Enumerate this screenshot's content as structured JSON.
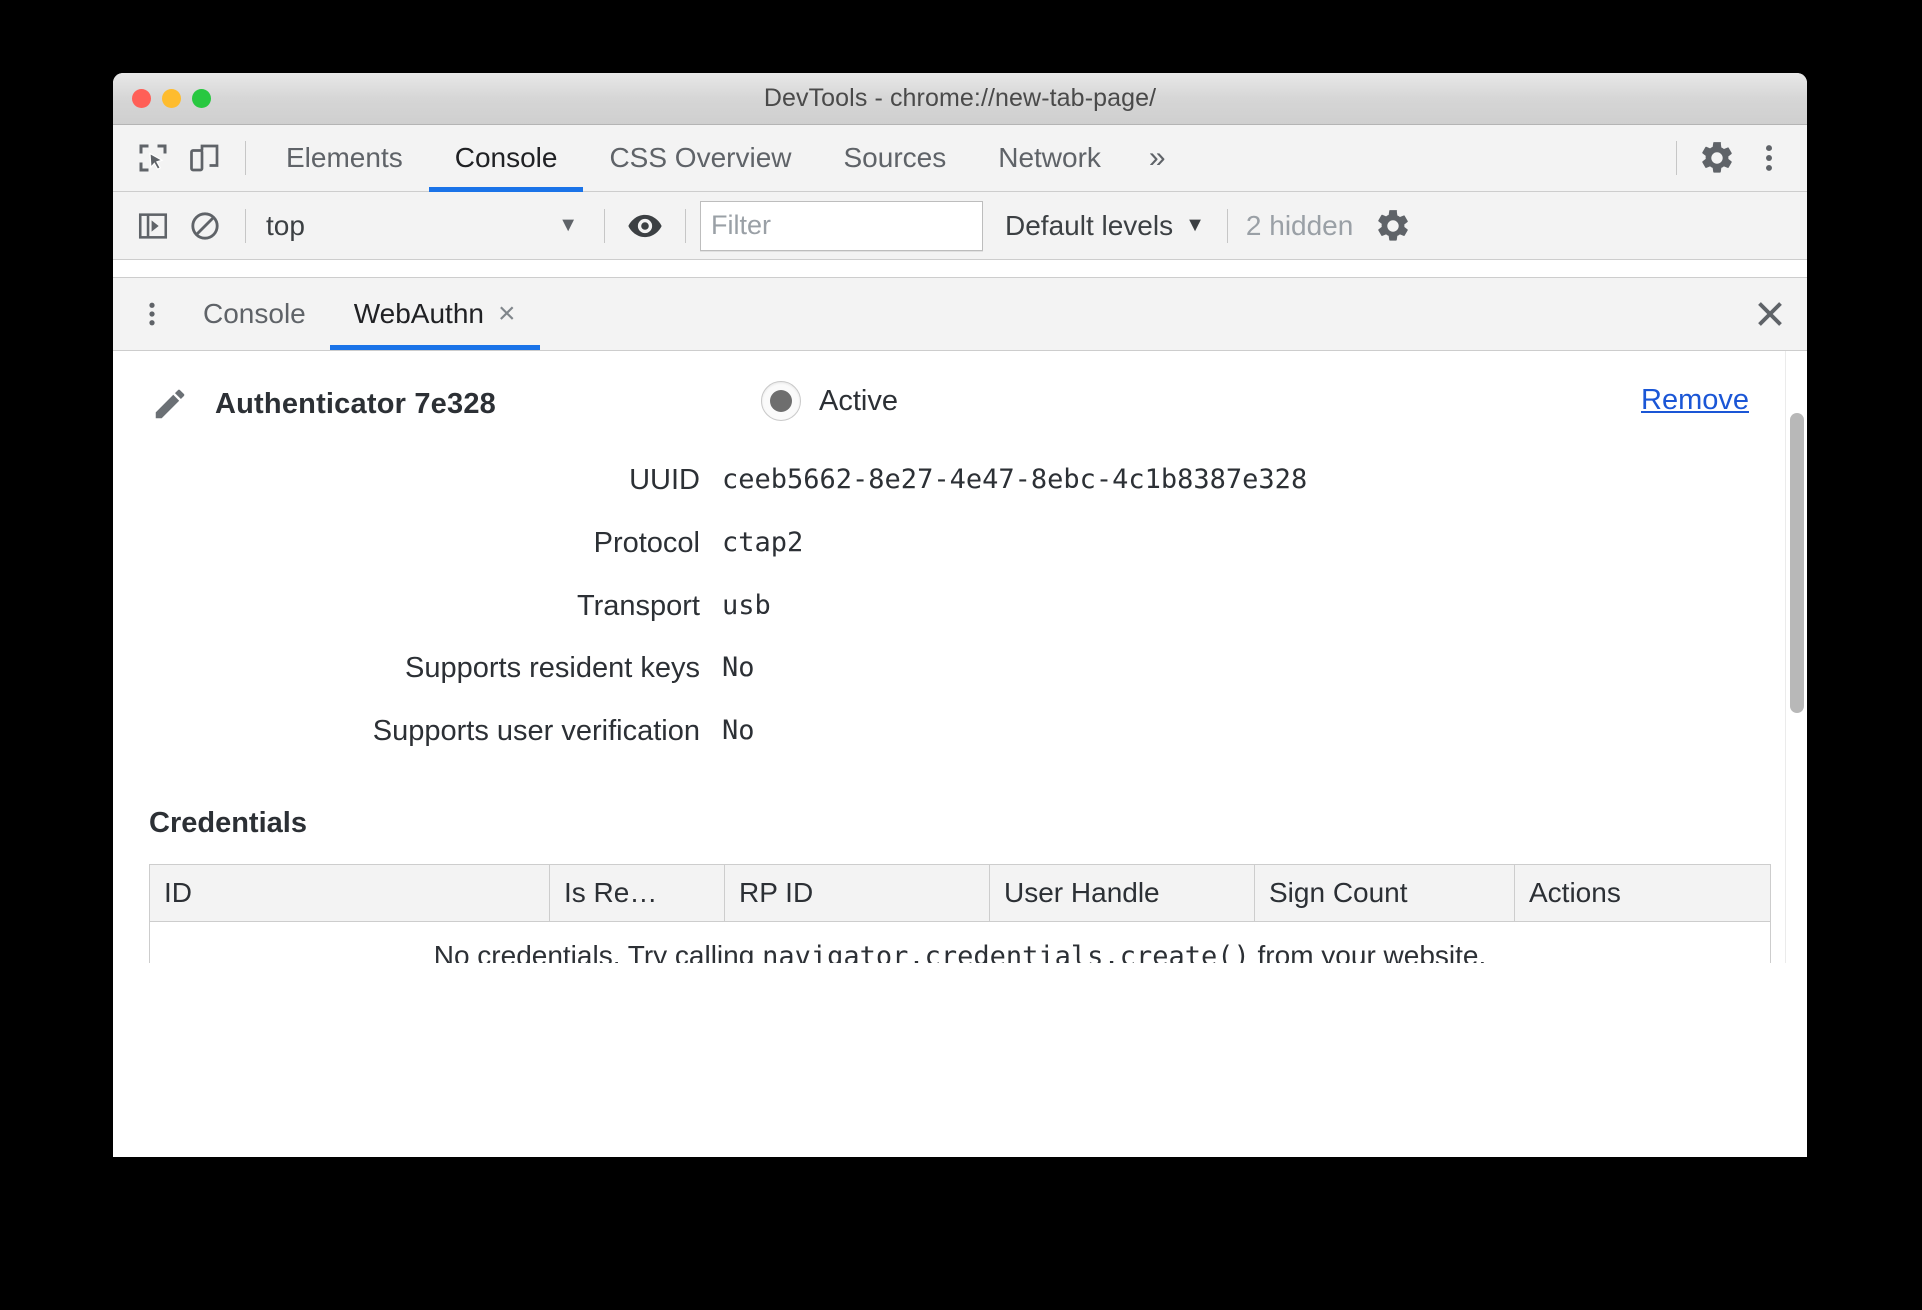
{
  "window": {
    "title": "DevTools - chrome://new-tab-page/",
    "traffic_lights": [
      "close",
      "minimize",
      "zoom"
    ],
    "colors": {
      "accent": "#1a73e8",
      "link": "#1a56d6",
      "close_dot": "#ff5f57",
      "minimize_dot": "#febc2e",
      "zoom_dot": "#28c840"
    }
  },
  "main_toolbar": {
    "inspect_icon": "inspect-element-icon",
    "device_toggle_icon": "device-toolbar-icon",
    "tabs": [
      {
        "label": "Elements",
        "active": false
      },
      {
        "label": "Console",
        "active": true
      },
      {
        "label": "CSS Overview",
        "active": false
      },
      {
        "label": "Sources",
        "active": false
      },
      {
        "label": "Network",
        "active": false
      }
    ],
    "more_tabs_label": "»",
    "settings_icon": "gear-icon",
    "main_menu_icon": "kebab-menu-icon"
  },
  "console_toolbar": {
    "sidebar_toggle_icon": "console-sidebar-icon",
    "clear_console_icon": "clear-console-icon",
    "context": {
      "value": "top",
      "caret": "▼"
    },
    "eye_icon": "live-expression-icon",
    "filter": {
      "value": "",
      "placeholder": "Filter"
    },
    "levels": {
      "label": "Default levels",
      "caret": "▼"
    },
    "hidden_messages": "2 hidden",
    "console_settings_icon": "gear-icon"
  },
  "drawer": {
    "menu_icon": "kebab-menu-icon",
    "tabs": [
      {
        "label": "Console",
        "active": false,
        "closable": false
      },
      {
        "label": "WebAuthn",
        "active": true,
        "closable": true,
        "close_glyph": "×"
      }
    ],
    "close_icon": "close-icon"
  },
  "webauthn": {
    "edit_icon": "pencil-icon",
    "authenticator_name": "Authenticator 7e328",
    "active_toggle": {
      "label": "Active",
      "checked": true
    },
    "remove_label": "Remove",
    "properties": [
      {
        "label": "UUID",
        "value": "ceeb5662-8e27-4e47-8ebc-4c1b8387e328"
      },
      {
        "label": "Protocol",
        "value": "ctap2"
      },
      {
        "label": "Transport",
        "value": "usb"
      },
      {
        "label": "Supports resident keys",
        "value": "No"
      },
      {
        "label": "Supports user verification",
        "value": "No"
      }
    ],
    "credentials": {
      "heading": "Credentials",
      "columns": [
        "ID",
        "Is Re…",
        "RP ID",
        "User Handle",
        "Sign Count",
        "Actions"
      ],
      "rows": [],
      "empty_message_prefix": "No credentials. Try calling ",
      "empty_message_code": "navigator.credentials.create()",
      "empty_message_suffix": " from your website."
    }
  }
}
